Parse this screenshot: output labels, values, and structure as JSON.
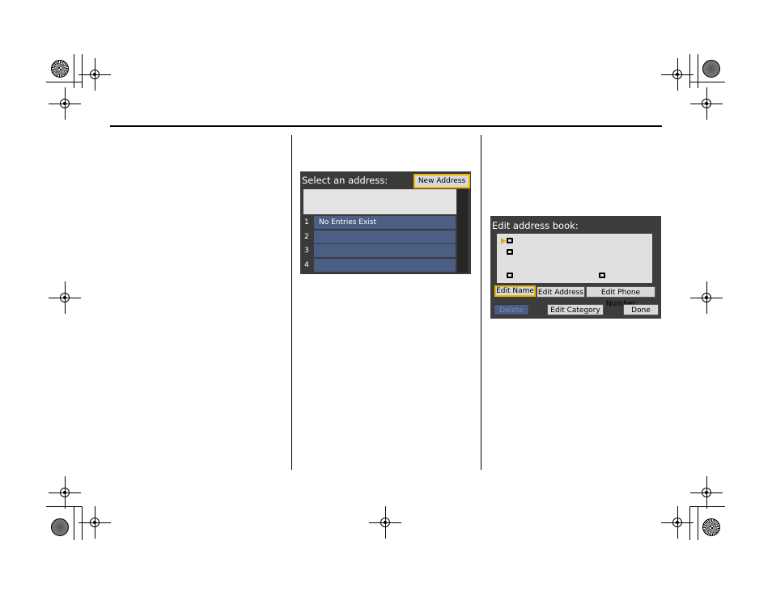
{
  "screen1": {
    "title": "Select an address:",
    "new_address_button": "New Address",
    "rows": [
      {
        "num": "1",
        "text": "No Entries Exist"
      },
      {
        "num": "2",
        "text": ""
      },
      {
        "num": "3",
        "text": ""
      },
      {
        "num": "4",
        "text": ""
      }
    ]
  },
  "screen2": {
    "title": "Edit address book:",
    "buttons": {
      "edit_name": "Edit Name",
      "edit_address": "Edit Address",
      "edit_phone": "Edit Phone Number",
      "delete": "Delete",
      "edit_category": "Edit Category",
      "done": "Done"
    },
    "cursor_color": "#f0a000"
  },
  "colors": {
    "highlight": "#f0b400",
    "row_blue": "#4b5e83"
  }
}
